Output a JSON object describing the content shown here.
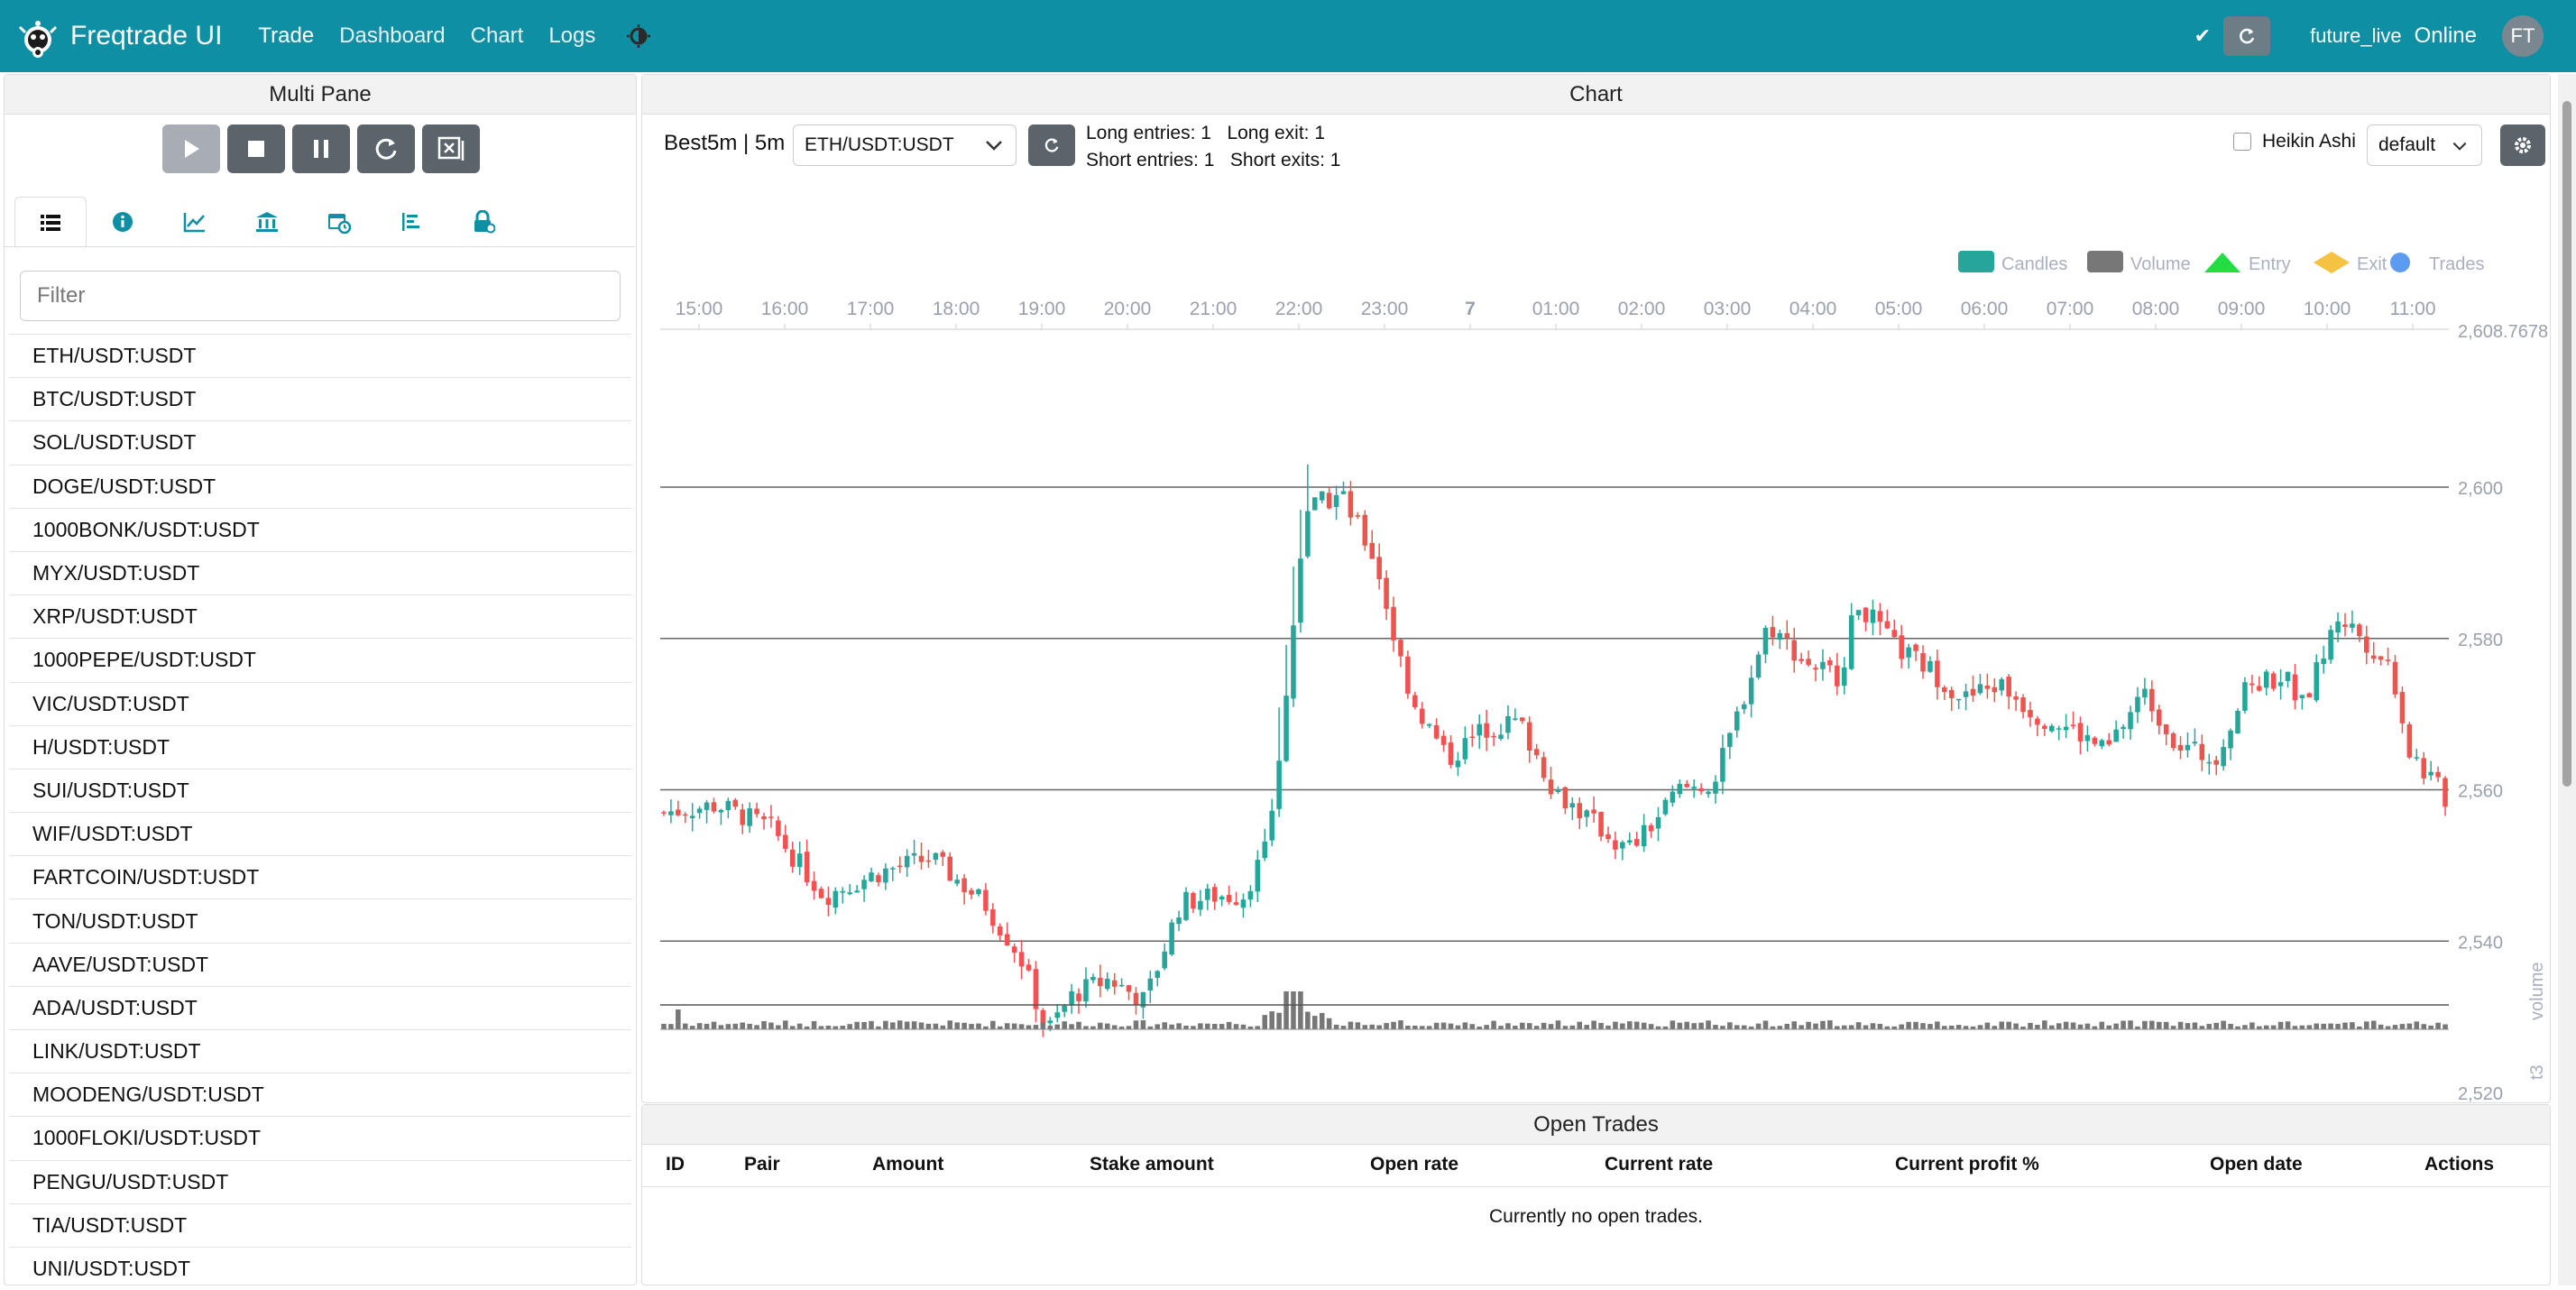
{
  "navbar": {
    "brand": "Freqtrade UI",
    "links": [
      "Trade",
      "Dashboard",
      "Chart",
      "Logs"
    ],
    "user": "future_live",
    "status": "Online",
    "avatar": "FT",
    "icons": {
      "logo": "freqtrade-logo-icon",
      "theme": "theme-toggle-icon",
      "check": "check-icon",
      "refresh": "refresh-icon"
    }
  },
  "left_pane": {
    "title": "Multi Pane",
    "controls": [
      "play-icon",
      "stop-icon",
      "pause-icon",
      "reload-icon",
      "force-exit-icon"
    ],
    "tabs": [
      "list-icon",
      "info-icon",
      "chart-line-icon",
      "bank-icon",
      "calendar-icon",
      "align-left-icon",
      "lock-icon"
    ],
    "filter_placeholder": "Filter",
    "pairs": [
      "ETH/USDT:USDT",
      "BTC/USDT:USDT",
      "SOL/USDT:USDT",
      "DOGE/USDT:USDT",
      "1000BONK/USDT:USDT",
      "MYX/USDT:USDT",
      "XRP/USDT:USDT",
      "1000PEPE/USDT:USDT",
      "VIC/USDT:USDT",
      "H/USDT:USDT",
      "SUI/USDT:USDT",
      "WIF/USDT:USDT",
      "FARTCOIN/USDT:USDT",
      "TON/USDT:USDT",
      "AAVE/USDT:USDT",
      "ADA/USDT:USDT",
      "LINK/USDT:USDT",
      "MOODENG/USDT:USDT",
      "1000FLOKI/USDT:USDT",
      "PENGU/USDT:USDT",
      "TIA/USDT:USDT",
      "UNI/USDT:USDT"
    ]
  },
  "chart_pane": {
    "title": "Chart",
    "strategy": "Best5m | 5m",
    "selected_pair": "ETH/USDT:USDT",
    "signals": {
      "long_entries": "Long entries: 1",
      "long_exit": "Long exit: 1",
      "short_entries": "Short entries: 1",
      "short_exits": "Short exits: 1"
    },
    "heikin_ashi": "Heikin Ashi",
    "layout": "default"
  },
  "chart_data": {
    "type": "candlestick",
    "legend": [
      {
        "name": "Candles",
        "color": "#26a69a"
      },
      {
        "name": "Volume",
        "color": "#777777"
      },
      {
        "name": "Entry",
        "color": "#22dd44"
      },
      {
        "name": "Exit",
        "color": "#f5c242"
      },
      {
        "name": "Trades",
        "color": "#5b9cf2"
      }
    ],
    "x_ticks": [
      "15:00",
      "16:00",
      "17:00",
      "18:00",
      "19:00",
      "20:00",
      "21:00",
      "22:00",
      "23:00",
      "7",
      "01:00",
      "02:00",
      "03:00",
      "04:00",
      "05:00",
      "06:00",
      "07:00",
      "08:00",
      "09:00",
      "10:00",
      "11:00"
    ],
    "y_ticks": [
      "2,600",
      "2,580",
      "2,560",
      "2,540",
      "2,520"
    ],
    "y_max_label": "2,608.7678",
    "ylim": [
      2519,
      2609
    ],
    "secondary_axis_labels": [
      "volume",
      "t3"
    ],
    "candle_color_up": "#26a69a",
    "candle_color_down": "#ef5350",
    "close_path": [
      [
        0,
        2557
      ],
      [
        0.03,
        2558
      ],
      [
        0.06,
        2555
      ],
      [
        0.09,
        2546
      ],
      [
        0.12,
        2549
      ],
      [
        0.15,
        2551
      ],
      [
        0.18,
        2545
      ],
      [
        0.2,
        2538
      ],
      [
        0.215,
        2528
      ],
      [
        0.23,
        2533
      ],
      [
        0.25,
        2535
      ],
      [
        0.27,
        2532
      ],
      [
        0.29,
        2545
      ],
      [
        0.31,
        2546
      ],
      [
        0.325,
        2546
      ],
      [
        0.34,
        2553
      ],
      [
        0.35,
        2575
      ],
      [
        0.36,
        2597
      ],
      [
        0.38,
        2599
      ],
      [
        0.4,
        2590
      ],
      [
        0.41,
        2580
      ],
      [
        0.42,
        2572
      ],
      [
        0.44,
        2564
      ],
      [
        0.46,
        2568
      ],
      [
        0.48,
        2569
      ],
      [
        0.5,
        2560
      ],
      [
        0.52,
        2556
      ],
      [
        0.54,
        2552
      ],
      [
        0.55,
        2554
      ],
      [
        0.57,
        2560
      ],
      [
        0.59,
        2561
      ],
      [
        0.61,
        2575
      ],
      [
        0.62,
        2582
      ],
      [
        0.64,
        2577
      ],
      [
        0.66,
        2575
      ],
      [
        0.67,
        2585
      ],
      [
        0.69,
        2579
      ],
      [
        0.71,
        2576
      ],
      [
        0.73,
        2572
      ],
      [
        0.75,
        2574
      ],
      [
        0.77,
        2570
      ],
      [
        0.79,
        2568
      ],
      [
        0.81,
        2565
      ],
      [
        0.83,
        2573
      ],
      [
        0.85,
        2566
      ],
      [
        0.87,
        2564
      ],
      [
        0.89,
        2574
      ],
      [
        0.91,
        2575
      ],
      [
        0.92,
        2571
      ],
      [
        0.94,
        2583
      ],
      [
        0.95,
        2581
      ],
      [
        0.97,
        2576
      ],
      [
        0.98,
        2565
      ],
      [
        1.0,
        2559
      ]
    ],
    "volume_spike_at": 0.355
  },
  "open_trades": {
    "title": "Open Trades",
    "columns": [
      "ID",
      "Pair",
      "Amount",
      "Stake amount",
      "Open rate",
      "Current rate",
      "Current profit %",
      "Open date",
      "Actions"
    ],
    "empty": "Currently no open trades."
  }
}
